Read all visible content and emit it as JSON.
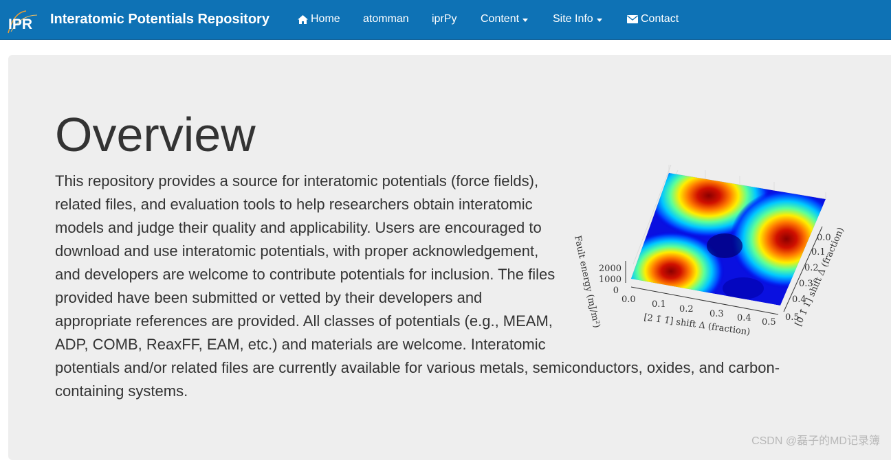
{
  "navbar": {
    "logo_text": "IPR",
    "brand": "Interatomic Potentials Repository",
    "items": [
      {
        "label": "Home",
        "icon": "home-icon"
      },
      {
        "label": "atomman"
      },
      {
        "label": "iprPy"
      },
      {
        "label": "Content",
        "dropdown": true
      },
      {
        "label": "Site Info",
        "dropdown": true
      },
      {
        "label": "Contact",
        "icon": "envelope-icon"
      }
    ],
    "colors": {
      "background": "#0e72b5",
      "text": "#ffffff"
    }
  },
  "main": {
    "title": "Overview",
    "lead": "This repository provides a source for interatomic potentials (force fields), related files, and evaluation tools to help researchers obtain interatomic models and judge their quality and applicability. Users are encouraged to download and use interatomic potentials, with proper acknowledgement, and developers are welcome to contribute potentials for inclusion. The files provided have been submitted or vetted by their developers and appropriate references are provided. All classes of potentials (e.g., MEAM, ADP, COMB, ReaxFF, EAM, etc.) and materials are welcome. Interatomic potentials and/or related files are currently available for various metals, semiconductors, oxides, and carbon-containing systems."
  },
  "figure": {
    "z_label": "Fault energy (mJ/m²)",
    "z_ticks": [
      "2000",
      "1000",
      "0"
    ],
    "x_label": "[2 1̄ 1̄] shift Δ (fraction)",
    "x_ticks": [
      "0.0",
      "0.1",
      "0.2",
      "0.3",
      "0.4",
      "0.5"
    ],
    "y_label": "[0 1̄ 1] shift Δ (fraction)",
    "y_ticks": [
      "0.0",
      "0.1",
      "0.2",
      "0.3",
      "0.4",
      "0.5"
    ]
  },
  "watermark": "CSDN @磊子的MD记录簿"
}
